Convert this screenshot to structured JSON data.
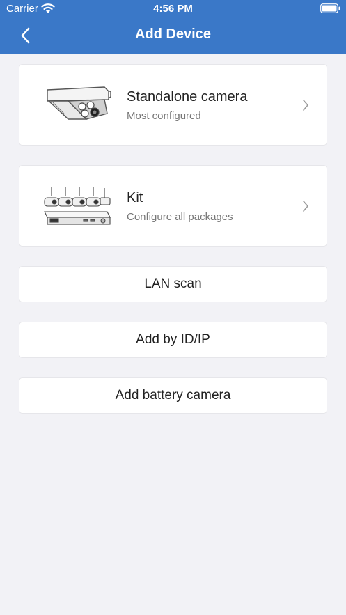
{
  "status_bar": {
    "carrier": "Carrier",
    "time": "4:56 PM"
  },
  "nav": {
    "title": "Add Device"
  },
  "cards": [
    {
      "title": "Standalone camera",
      "subtitle": "Most configured",
      "icon": "bullet-camera-icon"
    },
    {
      "title": "Kit",
      "subtitle": "Configure all packages",
      "icon": "nvr-kit-icon"
    }
  ],
  "buttons": {
    "lan_scan": "LAN scan",
    "add_by_id": "Add by ID/IP",
    "add_battery": "Add battery camera"
  },
  "colors": {
    "header": "#3a78c8",
    "background": "#f2f2f6",
    "card": "#ffffff"
  }
}
